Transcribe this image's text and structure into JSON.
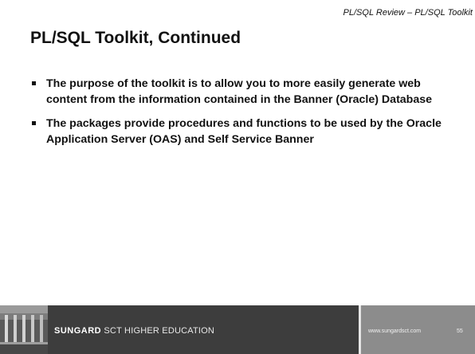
{
  "slide": {
    "header": "PL/SQL  Review – PL/SQL Toolkit",
    "title": "PL/SQL Toolkit, Continued",
    "bullets": [
      "The purpose of the toolkit is to allow you to more easily generate web content from the information contained in the Banner (Oracle) Database",
      "The packages provide procedures and functions to be used by the Oracle Application Server (OAS) and Self Service Banner"
    ]
  },
  "footer": {
    "brand_bold": "SUNGARD",
    "brand_rest": "SCT HIGHER EDUCATION",
    "url": "www.sungardsct.com",
    "page_number": "55"
  },
  "colors": {
    "footer_dark": "#3d3d3d",
    "footer_light": "#8c8c8c",
    "text": "#111111"
  }
}
